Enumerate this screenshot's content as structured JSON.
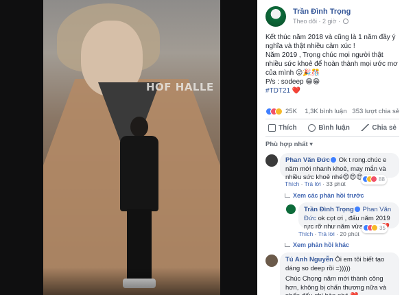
{
  "post": {
    "author": "Trần Đình Trọng",
    "follow": "Theo dõi",
    "time": "· 2 giờ ·",
    "lines": [
      "Kết thúc năm 2018 và cũng là 1 năm đầy ý nghĩa và thật nhiều cảm xúc !",
      "Năm 2019 , Trọng chúc mọi người thật nhiều sức khoẻ để hoàn thành mọi ước mơ của mình 😜🎉🎊",
      "P/s : sodeep 😁😁"
    ],
    "hashtag": "#TDT21",
    "hashtag_emoji": "❤️"
  },
  "stats": {
    "reactions": "25K",
    "comments": "1,3K bình luận",
    "shares": "353 lượt chia sẻ"
  },
  "actions": {
    "like": "Thích",
    "comment": "Bình luận",
    "share": "Chia sẻ"
  },
  "filter": "Phù hợp nhất ▾",
  "comments": [
    {
      "name": "Phan Văn Đức",
      "text": "Ok t rong.chúc e năm mới nhanh khoẻ, may mắn và nhiều sức khoẻ nhé😍😍😍",
      "like": "Thích",
      "reply": "Trả lời",
      "time": "33 phút",
      "reaction_count": "88"
    },
    {
      "name": "Trần Đình Trọng",
      "mention": "Phan Văn Đức",
      "text": "ok cọt ơi , đấu năm 2019 rực rỡ như năm vừa r nhé ❤️",
      "like": "Thích",
      "reply": "Trả lời",
      "time": "20 phút",
      "reaction_count": "35"
    },
    {
      "name": "Tú Anh Nguyễn",
      "text_line1": "Ôi em tôi biết tạo dáng so deep rồi =)))))",
      "text_line2": "Chúc Chọng năm mới thành công hơn, không bị chấn thương nữa và phấn đấu ghi bàn nhé ❤️"
    }
  ],
  "links": {
    "prev_replies": "Xem các phản hồi trước",
    "more_replies": "Xem phản hồi khác"
  },
  "photo": {
    "sign_text": "HOF HALLE"
  }
}
